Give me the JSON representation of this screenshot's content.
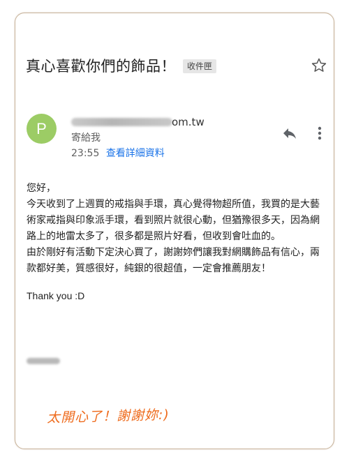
{
  "email": {
    "subject": "真心喜歡你們的飾品！",
    "label": "收件匣",
    "sender": {
      "avatar_letter": "P",
      "avatar_color": "#9ccc65",
      "domain_suffix": "om.tw",
      "recipient": "寄給我",
      "time": "23:55",
      "details_link": "查看詳細資料"
    },
    "icons": {
      "star": "star-outline-icon",
      "reply": "reply-icon",
      "more": "more-vert-icon"
    },
    "body": {
      "greeting": "您好，",
      "paragraph1": "今天收到了上週買的戒指與手環，真心覺得物超所值，我買的是大藝術家戒指與印象派手環，看到照片就很心動，但猶豫很多天，因為網路上的地雷太多了，很多都是照片好看，但收到會吐血的。",
      "paragraph2": " 由於剛好有活動下定決心買了，謝謝妳們讓我對網購飾品有信心，兩款都好美，質感很好，純銀的很超值，一定會推薦朋友！",
      "closing": "Thank you :D"
    }
  },
  "annotation": {
    "handwritten_note": "太開心了！謝謝妳:)",
    "color": "#ee6b1d"
  },
  "colors": {
    "frame_border": "#c8b39a",
    "link": "#1a73e8"
  }
}
